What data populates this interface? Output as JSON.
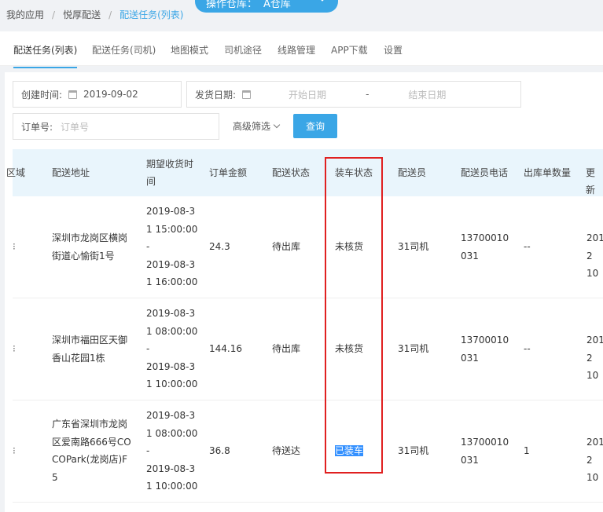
{
  "breadcrumb": {
    "item1": "我的应用",
    "item2": "悦厚配送",
    "item3": "配送任务(列表)"
  },
  "warehouse": {
    "label": "操作仓库：",
    "value": "A仓库"
  },
  "tabs": [
    "配送任务(列表)",
    "配送任务(司机)",
    "地图模式",
    "司机途径",
    "线路管理",
    "APP下载",
    "设置"
  ],
  "filters": {
    "created_label": "创建时间:",
    "created_value": "2019-09-02",
    "ship_label": "发货日期:",
    "start_placeholder": "开始日期",
    "dash": "-",
    "end_placeholder": "结束日期",
    "order_label": "订单号:",
    "order_placeholder": "订单号",
    "advanced": "高级筛选",
    "query": "查询"
  },
  "table": {
    "headers": {
      "region": "区域",
      "address": "配送地址",
      "expected_line1": "期望收货时",
      "expected_line2": "间",
      "amount": "订单金额",
      "delivery_status": "配送状态",
      "loading_status": "装车状态",
      "courier": "配送员",
      "courier_phone": "配送员电话",
      "outbound_count": "出库单数量",
      "updated": "更新"
    },
    "rows": [
      {
        "region": "⁝",
        "address": [
          "深圳市龙岗区横岗",
          "街道心愉街1号"
        ],
        "expected": [
          "2019-08-3",
          "1 15:00:00",
          "-",
          "2019-08-3",
          "1 16:00:00"
        ],
        "amount": "24.3",
        "delivery_status": "待出库",
        "loading_status": "未核货",
        "courier": "31司机",
        "phone": [
          "13700010",
          "031"
        ],
        "outbound": "--",
        "updated": [
          "201",
          "2 10"
        ]
      },
      {
        "region": "⁝",
        "address": [
          "深圳市福田区天御",
          "香山花园1栋"
        ],
        "expected": [
          "2019-08-3",
          "1 08:00:00",
          "-",
          "2019-08-3",
          "1 10:00:00"
        ],
        "amount": "144.16",
        "delivery_status": "待出库",
        "loading_status": "未核货",
        "courier": "31司机",
        "phone": [
          "13700010",
          "031"
        ],
        "outbound": "--",
        "updated": [
          "201",
          "2 10"
        ]
      },
      {
        "region": "⁝",
        "address": [
          "广东省深圳市龙岗",
          "区爱南路666号CO",
          "COPark(龙岗店)F",
          "5"
        ],
        "expected": [
          "2019-08-3",
          "1 08:00:00",
          "-",
          "2019-08-3",
          "1 10:00:00"
        ],
        "amount": "36.8",
        "delivery_status": "待送达",
        "loading_status": "已装车",
        "courier": "31司机",
        "phone": [
          "13700010",
          "031"
        ],
        "outbound": "1",
        "updated": [
          "201",
          "2 10"
        ]
      }
    ]
  }
}
